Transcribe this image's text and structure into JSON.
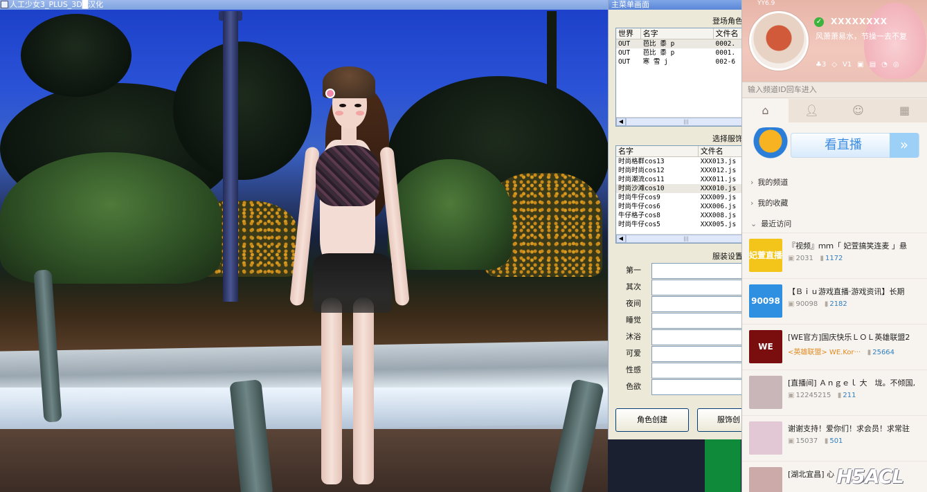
{
  "game_window": {
    "title": "人工少女3_PLUS_3D█汉化"
  },
  "dialog": {
    "title": "主菜单画面",
    "character_group": {
      "label": "登场角色",
      "columns": [
        "世界",
        "名字",
        "文件名"
      ],
      "rows": [
        [
          "OUT",
          "芭比 黍 p",
          "0002."
        ],
        [
          "OUT",
          "芭比 黍 p",
          "0001."
        ],
        [
          "OUT",
          "寒 雪 j",
          "002-6"
        ]
      ]
    },
    "costume_group": {
      "label": "选择服饰",
      "columns": [
        "名字",
        "文件名"
      ],
      "rows": [
        [
          "时尚格群cos13",
          "XXX013.js"
        ],
        [
          "时尚时尚cos12",
          "XXX012.js"
        ],
        [
          "时尚潮流cos11",
          "XXX011.js"
        ],
        [
          "时尚沙滩cos10",
          "XXX010.js"
        ],
        [
          "时尚牛仔cos9",
          "XXX009.js"
        ],
        [
          "时尚牛仔cos6",
          "XXX006.js"
        ],
        [
          "牛仔格子cos8",
          "XXX008.js"
        ],
        [
          "时尚牛仔cos5",
          "XXX005.js"
        ]
      ],
      "selected_index": 3
    },
    "settings_group": {
      "label": "服装设置",
      "rows": [
        "第一",
        "其次",
        "夜间",
        "睡觉",
        "沐浴",
        "可爱",
        "性感",
        "色欲"
      ]
    },
    "buttons": {
      "create_character": "角色创建",
      "create_costume": "服饰创"
    }
  },
  "yy": {
    "version": "YY6.9",
    "user_name": "XXXXXXXX",
    "signature": "风萧萧易水，节操一去不复",
    "badges": [
      "3",
      "1"
    ],
    "search_placeholder": "输入频道ID回车进入",
    "live_banner": "看直播",
    "nav": [
      "我的频道",
      "我的收藏",
      "最近访问"
    ],
    "channels": [
      {
        "thumb": "妃萱直播间",
        "title": "『视频』ｍｍ「 妃萱搞笑连麦 」悬",
        "id": "2031",
        "online": "1172",
        "color": "#f3c51a"
      },
      {
        "thumb": "90098",
        "title": "【Ｂｉｕ游戏直播·游戏资讯】长期",
        "id": "90098",
        "online": "2182",
        "color": "#2f8fe0"
      },
      {
        "thumb": "WE",
        "title": "[WE官方]国庆快乐ＬＯＬ英雄联盟2",
        "tag": "<英雄联盟> WE.Kor···",
        "online": "25664",
        "color": "#7a0e0e"
      },
      {
        "thumb": "",
        "title": "[直播间] Ａｎｇｅｌ 大　垅。不倾国,",
        "id": "12245215",
        "online": "211",
        "color": "#c9b6b8"
      },
      {
        "thumb": "",
        "title": "谢谢支持！爱你们！求会员！求常驻",
        "id": "15037",
        "online": "501",
        "color": "#e2c7d4"
      },
      {
        "thumb": "",
        "title": "[湖北宜昌] 心",
        "id": "",
        "online": "",
        "color": "#caa"
      }
    ],
    "watermark": "H5ACL"
  },
  "colors": {
    "dialog_bg": "#ece9d8",
    "titlebar": "#5b86d7",
    "yy_accent": "#3c8de0"
  }
}
